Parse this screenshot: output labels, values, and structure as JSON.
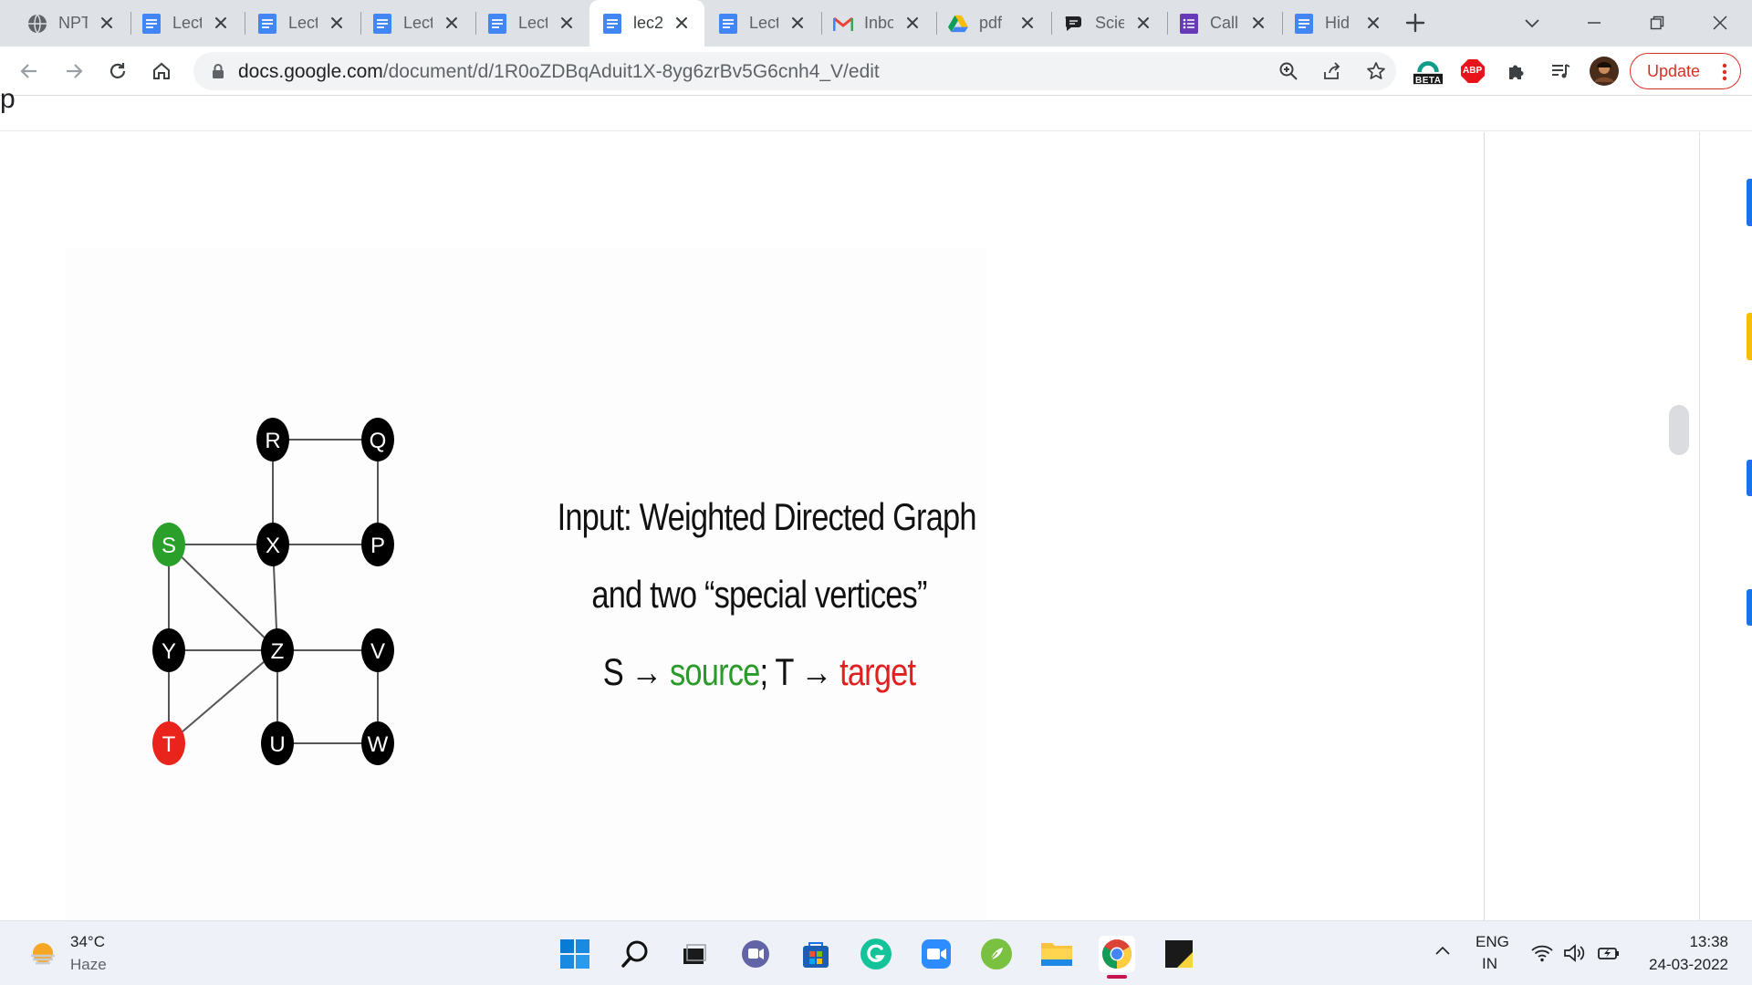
{
  "tabs": [
    {
      "title": "NPTEL",
      "icon": "globe-icon"
    },
    {
      "title": "Lecture",
      "icon": "docs-icon"
    },
    {
      "title": "Lecture",
      "icon": "docs-icon"
    },
    {
      "title": "Lecture",
      "icon": "docs-icon"
    },
    {
      "title": "Lecture",
      "icon": "docs-icon"
    },
    {
      "title": "lec2",
      "icon": "docs-icon",
      "active": true
    },
    {
      "title": "Lecture",
      "icon": "docs-icon"
    },
    {
      "title": "Inbox",
      "icon": "gmail-icon"
    },
    {
      "title": "pdf",
      "icon": "drive-icon"
    },
    {
      "title": "Scie",
      "icon": "chat-icon"
    },
    {
      "title": "Call",
      "icon": "forms-icon"
    },
    {
      "title": "Hid",
      "icon": "docs-icon"
    }
  ],
  "toolbar": {
    "url_domain": "docs.google.com",
    "url_path": "/document/d/1R0oZDBqAduit1X-8yg6zrBv5G6cnh4_V/edit",
    "ext_badge": "BETA",
    "abp_label": "ABP",
    "update_label": "Update"
  },
  "doc": {
    "header_letter": "p"
  },
  "slide": {
    "line1": "Input: Weighted Directed Graph",
    "line2": "and two “special vertices”",
    "line3_s": "S → ",
    "line3_source": "source",
    "line3_mid": "; T → ",
    "line3_target": "target",
    "nodes": [
      {
        "label": "R",
        "color": "#000000"
      },
      {
        "label": "Q",
        "color": "#000000"
      },
      {
        "label": "S",
        "color": "#2aa02a"
      },
      {
        "label": "X",
        "color": "#000000"
      },
      {
        "label": "P",
        "color": "#000000"
      },
      {
        "label": "Y",
        "color": "#000000"
      },
      {
        "label": "Z",
        "color": "#000000"
      },
      {
        "label": "V",
        "color": "#000000"
      },
      {
        "label": "T",
        "color": "#e8241c"
      },
      {
        "label": "U",
        "color": "#000000"
      },
      {
        "label": "W",
        "color": "#000000"
      }
    ],
    "edges": [
      [
        "R",
        "Q"
      ],
      [
        "R",
        "X"
      ],
      [
        "Q",
        "P"
      ],
      [
        "S",
        "X"
      ],
      [
        "X",
        "P"
      ],
      [
        "S",
        "Y"
      ],
      [
        "S",
        "Z"
      ],
      [
        "X",
        "Z"
      ],
      [
        "Y",
        "Z"
      ],
      [
        "Z",
        "V"
      ],
      [
        "Y",
        "T"
      ],
      [
        "Z",
        "T"
      ],
      [
        "Z",
        "U"
      ],
      [
        "V",
        "W"
      ],
      [
        "U",
        "W"
      ]
    ]
  },
  "taskbar": {
    "temp": "34°C",
    "weather": "Haze",
    "lang1": "ENG",
    "lang2": "IN",
    "time": "13:38",
    "date": "24-03-2022"
  }
}
